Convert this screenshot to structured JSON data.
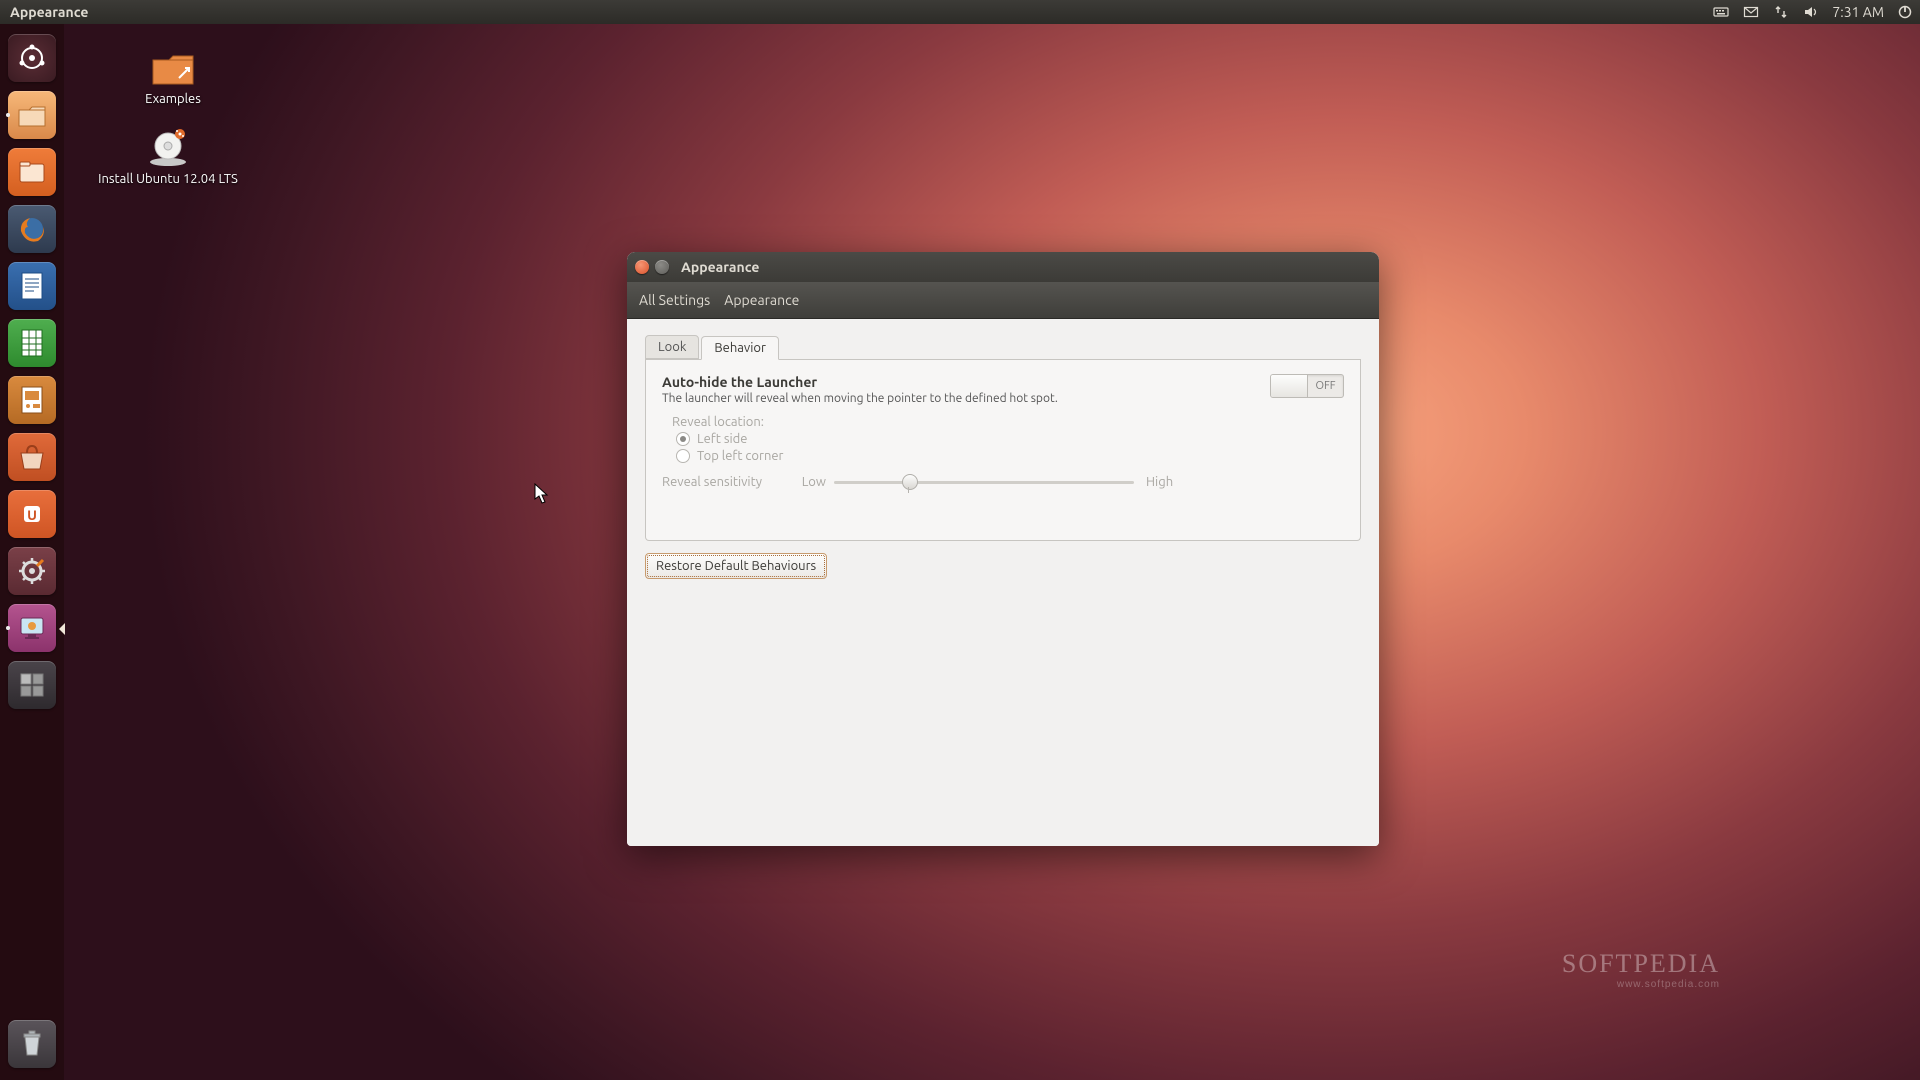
{
  "topbar": {
    "app": "Appearance",
    "clock": "7:31 AM"
  },
  "desktop": {
    "icons": [
      {
        "label": "Examples"
      },
      {
        "label": "Install Ubuntu 12.04 LTS"
      }
    ]
  },
  "launcher": {
    "items": [
      {
        "name": "dash"
      },
      {
        "name": "nautilus-home"
      },
      {
        "name": "nautilus"
      },
      {
        "name": "firefox"
      },
      {
        "name": "libreoffice-writer"
      },
      {
        "name": "libreoffice-calc"
      },
      {
        "name": "libreoffice-impress"
      },
      {
        "name": "ubuntu-software-center"
      },
      {
        "name": "ubuntu-one"
      },
      {
        "name": "system-settings"
      },
      {
        "name": "appearance",
        "active": true
      },
      {
        "name": "workspace-switcher"
      }
    ]
  },
  "window": {
    "title": "Appearance",
    "breadcrumb": {
      "root": "All Settings",
      "current": "Appearance"
    },
    "tabs": {
      "look": "Look",
      "behavior": "Behavior"
    },
    "behavior": {
      "autohide_title": "Auto-hide the Launcher",
      "autohide_sub": "The launcher will reveal when moving the pointer to the defined hot spot.",
      "toggle_label": "OFF",
      "reveal_location_label": "Reveal location:",
      "reveal_options": {
        "left": "Left side",
        "topleft": "Top left corner"
      },
      "sensitivity_label": "Reveal sensitivity",
      "sensitivity_low": "Low",
      "sensitivity_high": "High",
      "restore_button": "Restore Default Behaviours"
    }
  },
  "watermark": {
    "brand": "SOFTPEDIA",
    "url": "www.softpedia.com"
  }
}
